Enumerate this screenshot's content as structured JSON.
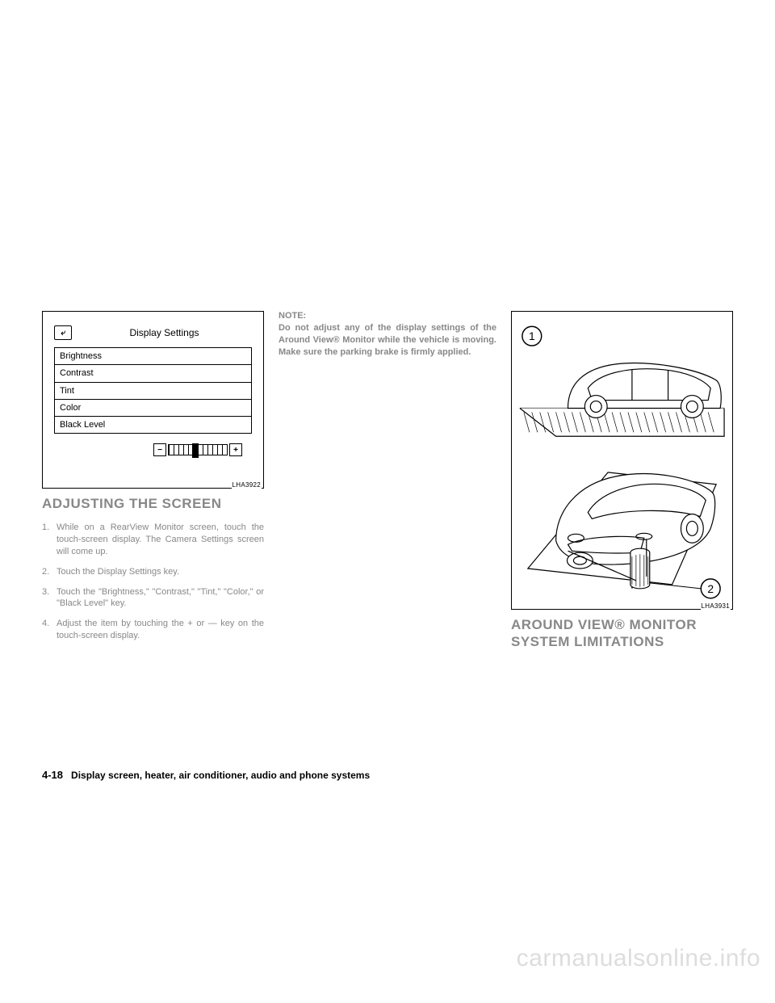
{
  "figure_left": {
    "code": "LHA3922",
    "screen_title": "Display Settings",
    "back_glyph": "⤶",
    "items": [
      "Brightness",
      "Contrast",
      "Tint",
      "Color",
      "Black Level"
    ],
    "minus": "−",
    "plus": "+"
  },
  "figure_right": {
    "code": "LHA3931",
    "callout1": "1",
    "callout2": "2"
  },
  "col1": {
    "heading": "ADJUSTING THE SCREEN",
    "steps": [
      "While on a RearView Monitor screen, touch the touch-screen display. The Camera Settings screen will come up.",
      "Touch the Display Settings key.",
      "Touch the \"Brightness,\" \"Contrast,\" \"Tint,\" \"Color,\" or \"Black Level\" key.",
      "Adjust the item by touching the + or — key on the touch-screen display."
    ]
  },
  "col2": {
    "note_label": "NOTE:",
    "note_body": "Do not adjust any of the display settings of the Around View® Monitor while the vehicle is moving. Make sure the parking brake is firmly applied."
  },
  "col3": {
    "heading": "AROUND VIEW® MONITOR SYSTEM LIMITATIONS"
  },
  "footer": {
    "page_number": "4-18",
    "section_title": "Display screen, heater, air conditioner, audio and phone systems"
  },
  "watermark": "carmanualsonline.info"
}
